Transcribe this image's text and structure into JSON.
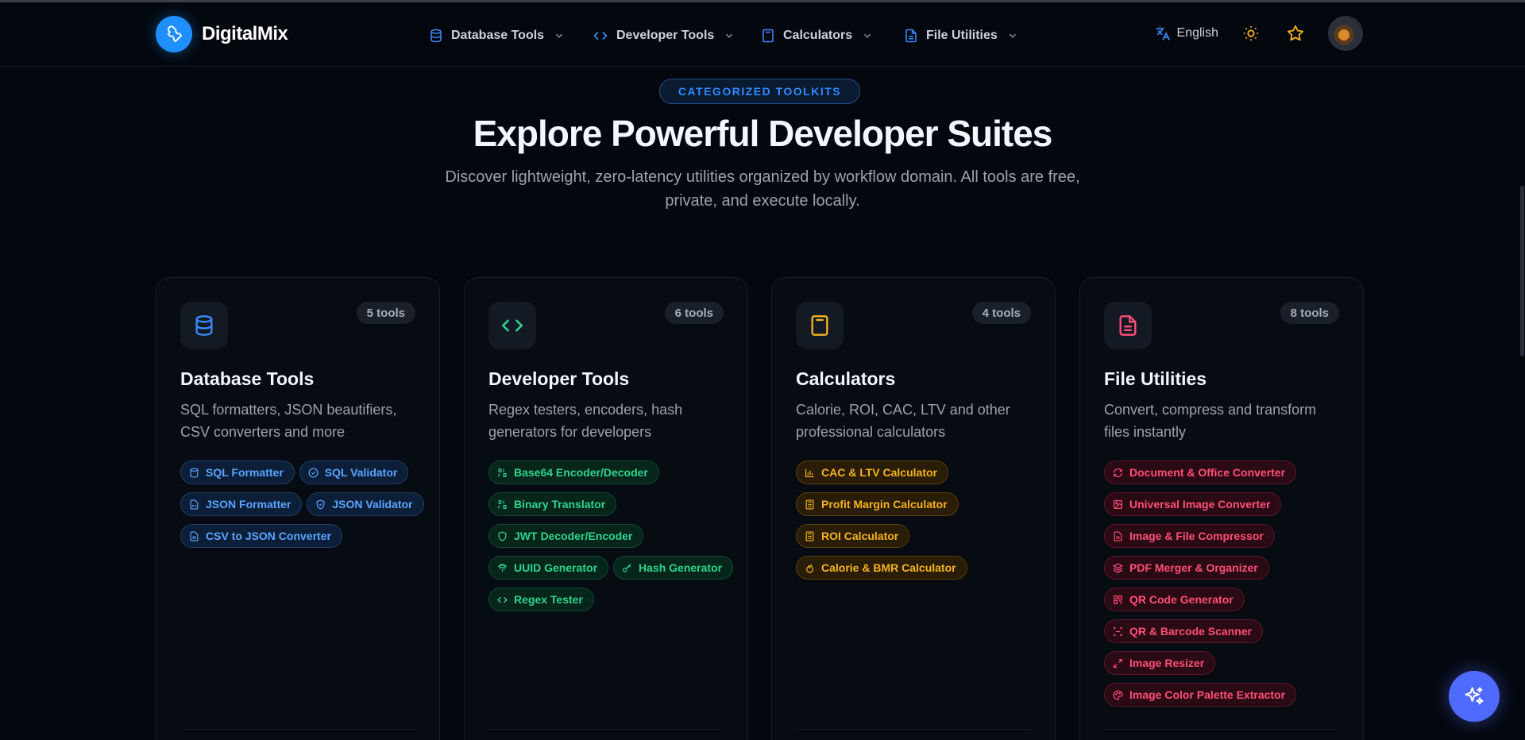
{
  "header": {
    "brand": "DigitalMix",
    "nav": [
      {
        "label": "Database Tools",
        "icon": "database-icon"
      },
      {
        "label": "Developer Tools",
        "icon": "code-icon"
      },
      {
        "label": "Calculators",
        "icon": "calculator-icon"
      },
      {
        "label": "File Utilities",
        "icon": "file-icon"
      }
    ],
    "language": "English"
  },
  "hero": {
    "pill": "CATEGORIZED TOOLKITS",
    "title": "Explore Powerful Developer Suites",
    "subtitle": "Discover lightweight, zero-latency utilities organized by workflow domain. All tools are free, private, and execute locally."
  },
  "cards": [
    {
      "title": "Database Tools",
      "count": "5 tools",
      "description": "SQL formatters, JSON beautifiers, CSV converters and more",
      "color": "#3b8cff",
      "tools": [
        "SQL Formatter",
        "SQL Validator",
        "JSON Formatter",
        "JSON Validator",
        "CSV to JSON Converter"
      ]
    },
    {
      "title": "Developer Tools",
      "count": "6 tools",
      "description": "Regex testers, encoders, hash generators for developers",
      "color": "#2fd58e",
      "tools": [
        "Base64 Encoder/Decoder",
        "Binary Translator",
        "JWT Decoder/Encoder",
        "UUID Generator",
        "Hash Generator",
        "Regex Tester"
      ]
    },
    {
      "title": "Calculators",
      "count": "4 tools",
      "description": "Calorie, ROI, CAC, LTV and other professional calculators",
      "color": "#f5b321",
      "tools": [
        "CAC & LTV Calculator",
        "Profit Margin Calculator",
        "ROI Calculator",
        "Calorie & BMR Calculator"
      ]
    },
    {
      "title": "File Utilities",
      "count": "8 tools",
      "description": "Convert, compress and transform files instantly",
      "color": "#ff4f78",
      "tools": [
        "Document & Office Converter",
        "Universal Image Converter",
        "Image & File Compressor",
        "PDF Merger & Organizer",
        "QR Code Generator",
        "QR & Barcode Scanner",
        "Image Resizer",
        "Image Color Palette Extractor"
      ]
    }
  ]
}
